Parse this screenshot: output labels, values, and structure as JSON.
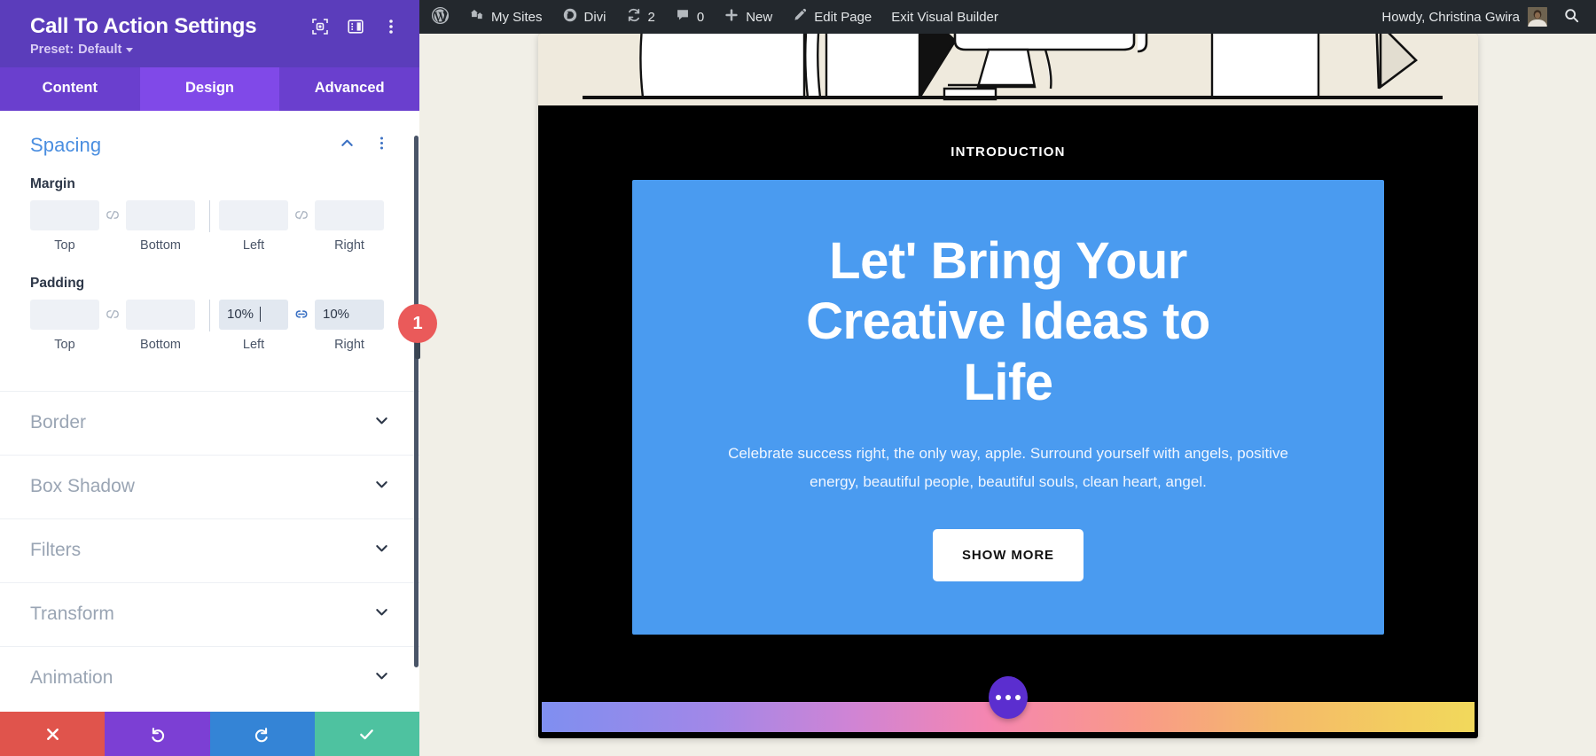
{
  "panel": {
    "title": "Call To Action Settings",
    "preset_prefix": "Preset:",
    "preset_value": "Default",
    "header_icons": [
      "focus-target-icon",
      "layout-panel-icon",
      "kebab-menu-icon"
    ],
    "tabs": [
      {
        "label": "Content",
        "active": false
      },
      {
        "label": "Design",
        "active": true
      },
      {
        "label": "Advanced",
        "active": false
      }
    ],
    "spacing": {
      "title": "Spacing",
      "collapse_icon": "chevron-up-icon",
      "menu_icon": "kebab-menu-icon",
      "margin": {
        "label": "Margin",
        "fields": [
          {
            "label": "Top",
            "value": "",
            "placeholder": ""
          },
          {
            "label": "Bottom",
            "value": "",
            "placeholder": ""
          },
          {
            "label": "Left",
            "value": "",
            "placeholder": ""
          },
          {
            "label": "Right",
            "value": "",
            "placeholder": ""
          }
        ],
        "link_left_state": "unlinked",
        "link_right_state": "unlinked"
      },
      "padding": {
        "label": "Padding",
        "fields": [
          {
            "label": "Top",
            "value": "",
            "placeholder": ""
          },
          {
            "label": "Bottom",
            "value": "",
            "placeholder": ""
          },
          {
            "label": "Left",
            "value": "10%",
            "placeholder": ""
          },
          {
            "label": "Right",
            "value": "10%",
            "placeholder": ""
          }
        ],
        "link_left_state": "unlinked",
        "link_right_state": "linked"
      }
    },
    "accordion": [
      {
        "label": "Border"
      },
      {
        "label": "Box Shadow"
      },
      {
        "label": "Filters"
      },
      {
        "label": "Transform"
      },
      {
        "label": "Animation"
      }
    ],
    "footer": [
      {
        "name": "cancel",
        "icon": "close-x-icon",
        "color": "#e0544c"
      },
      {
        "name": "undo",
        "icon": "undo-arrow-icon",
        "color": "#7c3fd4"
      },
      {
        "name": "redo",
        "icon": "redo-arrow-icon",
        "color": "#3484d6"
      },
      {
        "name": "save",
        "icon": "checkmark-icon",
        "color": "#4ec2a0"
      }
    ]
  },
  "adminbar": {
    "items": [
      {
        "icon": "wordpress-logo-icon",
        "label": ""
      },
      {
        "icon": "my-sites-icon",
        "label": "My Sites"
      },
      {
        "icon": "divi-icon",
        "label": "Divi"
      },
      {
        "icon": "updates-icon",
        "label": "2"
      },
      {
        "icon": "comments-icon",
        "label": "0"
      },
      {
        "icon": "plus-icon",
        "label": "New"
      },
      {
        "icon": "pencil-icon",
        "label": "Edit Page"
      },
      {
        "icon": "",
        "label": "Exit Visual Builder"
      }
    ],
    "howdy": "Howdy, Christina Gwira",
    "avatar_icon": "user-avatar",
    "search_icon": "search-icon"
  },
  "page": {
    "intro_label": "INTRODUCTION",
    "heading": "Let' Bring Your Creative Ideas to Life",
    "paragraph": "Celebrate success right, the only way, apple. Surround yourself with angels, positive energy, beautiful people, beautiful souls, clean heart, angel.",
    "button_label": "SHOW MORE",
    "fab_icon": "ellipsis-icon",
    "colors": {
      "cta_background": "#4a9bf0",
      "section_background": "#000000",
      "illustration_background": "#efeadd",
      "canvas_background": "#f1efe7"
    }
  },
  "annotation": {
    "step_number": "1"
  }
}
